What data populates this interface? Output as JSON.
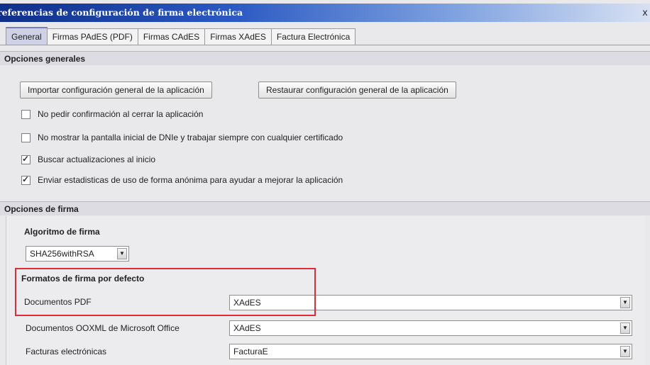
{
  "window": {
    "title": "referencias de configuración de firma electrónica",
    "close_glyph": "x"
  },
  "tabs": [
    {
      "label": "General",
      "active": true
    },
    {
      "label": "Firmas PAdES (PDF)",
      "active": false
    },
    {
      "label": "Firmas CAdES",
      "active": false
    },
    {
      "label": "Firmas XAdES",
      "active": false
    },
    {
      "label": "Factura Electrónica",
      "active": false
    }
  ],
  "general": {
    "heading": "Opciones generales",
    "import_button": "Importar configuración general de la aplicación",
    "restore_button": "Restaurar configuración general de la aplicación",
    "options": [
      {
        "label": "No pedir confirmación al cerrar la aplicación",
        "checked": false
      },
      {
        "label": "No mostrar la pantalla inicial de DNIe y trabajar siempre con cualquier certificado",
        "checked": false
      },
      {
        "label": "Buscar actualizaciones al inicio",
        "checked": true
      },
      {
        "label": "Enviar estadisticas de uso de forma anónima para ayudar a mejorar la aplicación",
        "checked": true
      }
    ]
  },
  "signature": {
    "heading": "Opciones de firma",
    "algorithm_label": "Algoritmo de firma",
    "algorithm_value": "SHA256withRSA",
    "formats_label": "Formatos de firma por defecto",
    "formats": [
      {
        "label": "Documentos PDF",
        "value": "XAdES"
      },
      {
        "label": "Documentos OOXML de Microsoft Office",
        "value": "XAdES"
      },
      {
        "label": "Facturas electrónicas",
        "value": "FacturaE"
      }
    ]
  },
  "colors": {
    "title_bar": "#1a3c9c",
    "highlight_box": "#e02b38",
    "active_tab": "#cfd2e6"
  }
}
